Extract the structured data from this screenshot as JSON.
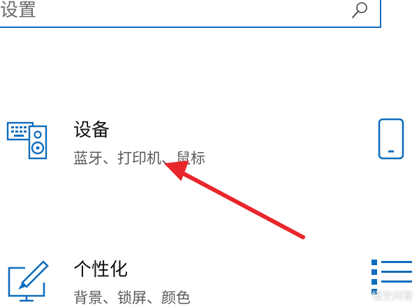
{
  "search": {
    "value": "设置"
  },
  "tiles": [
    {
      "title": "设备",
      "subtitle": "蓝牙、打印机、鼠标",
      "icon": "keyboard-speaker-icon"
    },
    {
      "title": "个性化",
      "subtitle": "背景、锁屏、颜色",
      "icon": "paint-monitor-icon"
    }
  ],
  "right_column": {
    "icons": [
      "phone-icon",
      "list-icon"
    ]
  },
  "annotation": {
    "arrow": "red-arrow-pointing-to-printer"
  },
  "watermark": {
    "text": "悟空问答"
  },
  "colors": {
    "accent": "#0f6cbd",
    "arrow": "#e8262b",
    "subtitle": "#595959"
  }
}
